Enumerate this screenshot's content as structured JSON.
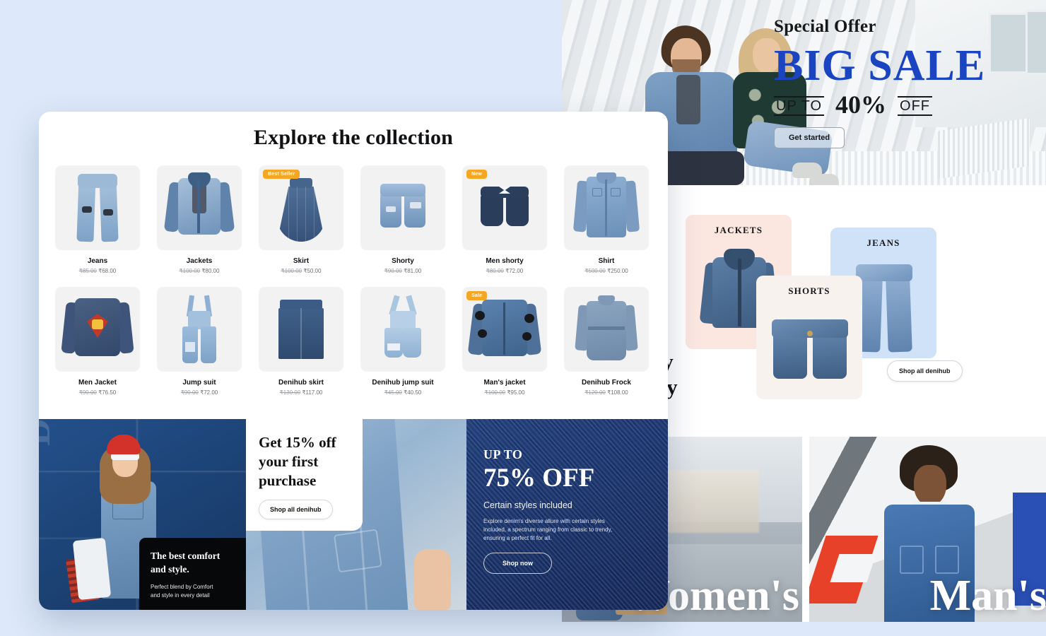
{
  "hero": {
    "eyebrow": "Special Offer",
    "headline": "BIG SALE",
    "up_to": "UP TO",
    "percent": "40%",
    "off": "OFF",
    "cta": "Get started",
    "accent_color": "#1a44c0"
  },
  "category": {
    "title_line1": "Shop by",
    "title_line2": "category",
    "cta": "Shop all denihub",
    "cards": [
      {
        "label": "JACKETS",
        "bg": "#fbe7e0"
      },
      {
        "label": "JEANS",
        "bg": "#cfe2f8"
      },
      {
        "label": "SHORTS",
        "bg": "#f8f2ef"
      }
    ]
  },
  "gender_panels": [
    {
      "label": "Women's"
    },
    {
      "label": "Man's"
    }
  ],
  "collection": {
    "title": "Explore the collection",
    "badge_color": "#f5a623",
    "products": [
      {
        "name": "Jeans",
        "old_price": "₹85.00",
        "price": "₹68.00",
        "badge": null
      },
      {
        "name": "Jackets",
        "old_price": "₹100.00",
        "price": "₹80.00",
        "badge": null
      },
      {
        "name": "Skirt",
        "old_price": "₹100.00",
        "price": "₹50.00",
        "badge": "Best Seller"
      },
      {
        "name": "Shorty",
        "old_price": "₹90.00",
        "price": "₹81.00",
        "badge": null
      },
      {
        "name": "Men shorty",
        "old_price": "₹80.00",
        "price": "₹72.00",
        "badge": "New"
      },
      {
        "name": "Shirt",
        "old_price": "₹500.00",
        "price": "₹250.00",
        "badge": null
      },
      {
        "name": "Men Jacket",
        "old_price": "₹90.00",
        "price": "₹76.50",
        "badge": null
      },
      {
        "name": "Jump suit",
        "old_price": "₹90.00",
        "price": "₹72.00",
        "badge": null
      },
      {
        "name": "Denihub skirt",
        "old_price": "₹130.00",
        "price": "₹117.00",
        "badge": null
      },
      {
        "name": "Denihub jump suit",
        "old_price": "₹45.00",
        "price": "₹40.50",
        "badge": null
      },
      {
        "name": "Man's jacket",
        "old_price": "₹100.00",
        "price": "₹95.00",
        "badge": "Sale"
      },
      {
        "name": "Denihub Frock",
        "old_price": "₹120.00",
        "price": "₹108.00",
        "badge": null
      }
    ]
  },
  "promo_photo": {
    "watermark": "DUNGRI",
    "dark_title_line1": "The best  comfort",
    "dark_title_line2": "and style.",
    "dark_sub_line1": "Perfect blend by Comfort",
    "dark_sub_line2": "and style in every detail"
  },
  "offer_card": {
    "title_line1": "Get 15% off",
    "title_line2": "your  first",
    "title_line3": "purchase",
    "cta": "Shop all denihub"
  },
  "denim_promo": {
    "up_to": "UP TO",
    "headline": "75% OFF",
    "subtitle": "Certain styles included",
    "body": "Explore denim's diverse allure with certain styles included, a spectrum ranging from classic to trendy, ensuring a perfect fit for all.",
    "cta": "Shop now"
  }
}
